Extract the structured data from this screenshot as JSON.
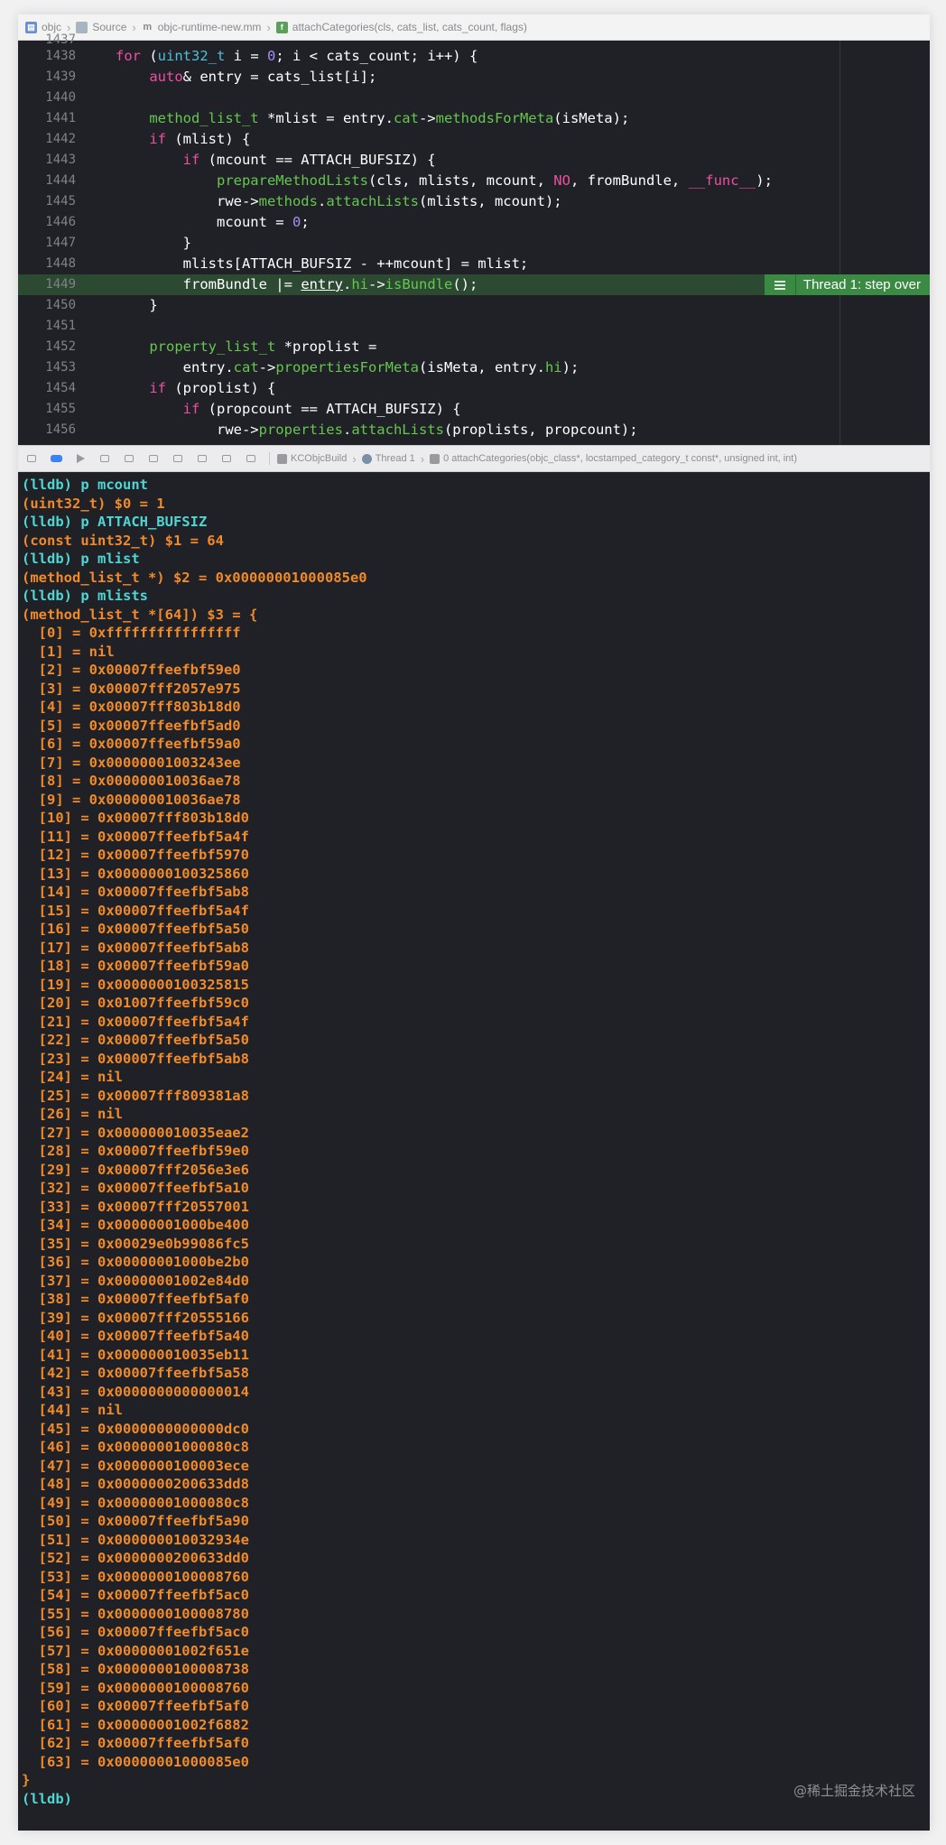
{
  "jumpbar": {
    "items": [
      {
        "label": "objc",
        "icon": "project-icon"
      },
      {
        "label": "Source",
        "icon": "folder-icon"
      },
      {
        "label": "objc-runtime-new.mm",
        "icon": "m-file-icon"
      },
      {
        "label": "attachCategories(cls, cats_list, cats_count, flags)",
        "icon": "function-icon"
      }
    ]
  },
  "editor": {
    "partial_top_line": "1437",
    "lines": [
      {
        "num": "1438"
      },
      {
        "num": "1439"
      },
      {
        "num": "1440"
      },
      {
        "num": "1441"
      },
      {
        "num": "1442"
      },
      {
        "num": "1443"
      },
      {
        "num": "1444"
      },
      {
        "num": "1445"
      },
      {
        "num": "1446"
      },
      {
        "num": "1447"
      },
      {
        "num": "1448"
      },
      {
        "num": "1449"
      },
      {
        "num": "1450"
      },
      {
        "num": "1451"
      },
      {
        "num": "1452"
      },
      {
        "num": "1453"
      },
      {
        "num": "1454"
      },
      {
        "num": "1455"
      },
      {
        "num": "1456"
      }
    ],
    "badge": "Thread 1: step over"
  },
  "debugbar": {
    "target": "KCObjcBuild",
    "thread": "Thread 1",
    "frame": "0 attachCategories(objc_class*, locstamped_category_t const*, unsigned int, int)"
  },
  "console": {
    "lines": [
      {
        "t": "cmd",
        "text": "(lldb) p mcount"
      },
      {
        "t": "out",
        "text": "(uint32_t) $0 = 1"
      },
      {
        "t": "cmd",
        "text": "(lldb) p ATTACH_BUFSIZ"
      },
      {
        "t": "out",
        "text": "(const uint32_t) $1 = 64"
      },
      {
        "t": "cmd",
        "text": "(lldb) p mlist"
      },
      {
        "t": "out",
        "text": "(method_list_t *) $2 = 0x00000001000085e0"
      },
      {
        "t": "cmd",
        "text": "(lldb) p mlists"
      },
      {
        "t": "out",
        "text": "(method_list_t *[64]) $3 = {"
      },
      {
        "t": "out",
        "text": "  [0] = 0xffffffffffffffff"
      },
      {
        "t": "out",
        "text": "  [1] = nil"
      },
      {
        "t": "out",
        "text": "  [2] = 0x00007ffeefbf59e0"
      },
      {
        "t": "out",
        "text": "  [3] = 0x00007fff2057e975"
      },
      {
        "t": "out",
        "text": "  [4] = 0x00007fff803b18d0"
      },
      {
        "t": "out",
        "text": "  [5] = 0x00007ffeefbf5ad0"
      },
      {
        "t": "out",
        "text": "  [6] = 0x00007ffeefbf59a0"
      },
      {
        "t": "out",
        "text": "  [7] = 0x00000001003243ee"
      },
      {
        "t": "out",
        "text": "  [8] = 0x000000010036ae78"
      },
      {
        "t": "out",
        "text": "  [9] = 0x000000010036ae78"
      },
      {
        "t": "out",
        "text": "  [10] = 0x00007fff803b18d0"
      },
      {
        "t": "out",
        "text": "  [11] = 0x00007ffeefbf5a4f"
      },
      {
        "t": "out",
        "text": "  [12] = 0x00007ffeefbf5970"
      },
      {
        "t": "out",
        "text": "  [13] = 0x0000000100325860"
      },
      {
        "t": "out",
        "text": "  [14] = 0x00007ffeefbf5ab8"
      },
      {
        "t": "out",
        "text": "  [15] = 0x00007ffeefbf5a4f"
      },
      {
        "t": "out",
        "text": "  [16] = 0x00007ffeefbf5a50"
      },
      {
        "t": "out",
        "text": "  [17] = 0x00007ffeefbf5ab8"
      },
      {
        "t": "out",
        "text": "  [18] = 0x00007ffeefbf59a0"
      },
      {
        "t": "out",
        "text": "  [19] = 0x0000000100325815"
      },
      {
        "t": "out",
        "text": "  [20] = 0x01007ffeefbf59c0"
      },
      {
        "t": "out",
        "text": "  [21] = 0x00007ffeefbf5a4f"
      },
      {
        "t": "out",
        "text": "  [22] = 0x00007ffeefbf5a50"
      },
      {
        "t": "out",
        "text": "  [23] = 0x00007ffeefbf5ab8"
      },
      {
        "t": "out",
        "text": "  [24] = nil"
      },
      {
        "t": "out",
        "text": "  [25] = 0x00007fff809381a8"
      },
      {
        "t": "out",
        "text": "  [26] = nil"
      },
      {
        "t": "out",
        "text": "  [27] = 0x000000010035eae2"
      },
      {
        "t": "out",
        "text": "  [28] = 0x00007ffeefbf59e0"
      },
      {
        "t": "out",
        "text": "  [29] = 0x00007fff2056e3e6"
      },
      {
        "t": "out",
        "text": "  [32] = 0x00007ffeefbf5a10"
      },
      {
        "t": "out",
        "text": "  [33] = 0x00007fff20557001"
      },
      {
        "t": "out",
        "text": "  [34] = 0x00000001000be400"
      },
      {
        "t": "out",
        "text": "  [35] = 0x00029e0b99086fc5"
      },
      {
        "t": "out",
        "text": "  [36] = 0x00000001000be2b0"
      },
      {
        "t": "out",
        "text": "  [37] = 0x00000001002e84d0"
      },
      {
        "t": "out",
        "text": "  [38] = 0x00007ffeefbf5af0"
      },
      {
        "t": "out",
        "text": "  [39] = 0x00007fff20555166"
      },
      {
        "t": "out",
        "text": "  [40] = 0x00007ffeefbf5a40"
      },
      {
        "t": "out",
        "text": "  [41] = 0x000000010035eb11"
      },
      {
        "t": "out",
        "text": "  [42] = 0x00007ffeefbf5a58"
      },
      {
        "t": "out",
        "text": "  [43] = 0x0000000000000014"
      },
      {
        "t": "out",
        "text": "  [44] = nil"
      },
      {
        "t": "out",
        "text": "  [45] = 0x0000000000000dc0"
      },
      {
        "t": "out",
        "text": "  [46] = 0x00000001000080c8"
      },
      {
        "t": "out",
        "text": "  [47] = 0x0000000100003ece"
      },
      {
        "t": "out",
        "text": "  [48] = 0x0000000200633dd8"
      },
      {
        "t": "out",
        "text": "  [49] = 0x00000001000080c8"
      },
      {
        "t": "out",
        "text": "  [50] = 0x00007ffeefbf5a90"
      },
      {
        "t": "out",
        "text": "  [51] = 0x000000010032934e"
      },
      {
        "t": "out",
        "text": "  [52] = 0x0000000200633dd0"
      },
      {
        "t": "out",
        "text": "  [53] = 0x0000000100008760"
      },
      {
        "t": "out",
        "text": "  [54] = 0x00007ffeefbf5ac0"
      },
      {
        "t": "out",
        "text": "  [55] = 0x0000000100008780"
      },
      {
        "t": "out",
        "text": "  [56] = 0x00007ffeefbf5ac0"
      },
      {
        "t": "out",
        "text": "  [57] = 0x00000001002f651e"
      },
      {
        "t": "out",
        "text": "  [58] = 0x0000000100008738"
      },
      {
        "t": "out",
        "text": "  [59] = 0x0000000100008760"
      },
      {
        "t": "out",
        "text": "  [60] = 0x00007ffeefbf5af0"
      },
      {
        "t": "out",
        "text": "  [61] = 0x00000001002f6882"
      },
      {
        "t": "out",
        "text": "  [62] = 0x00007ffeefbf5af0"
      },
      {
        "t": "out",
        "text": "  [63] = 0x00000001000085e0"
      },
      {
        "t": "out",
        "text": "}"
      },
      {
        "t": "cmd",
        "text": "(lldb)"
      }
    ]
  },
  "watermark": "@稀土掘金技术社区"
}
